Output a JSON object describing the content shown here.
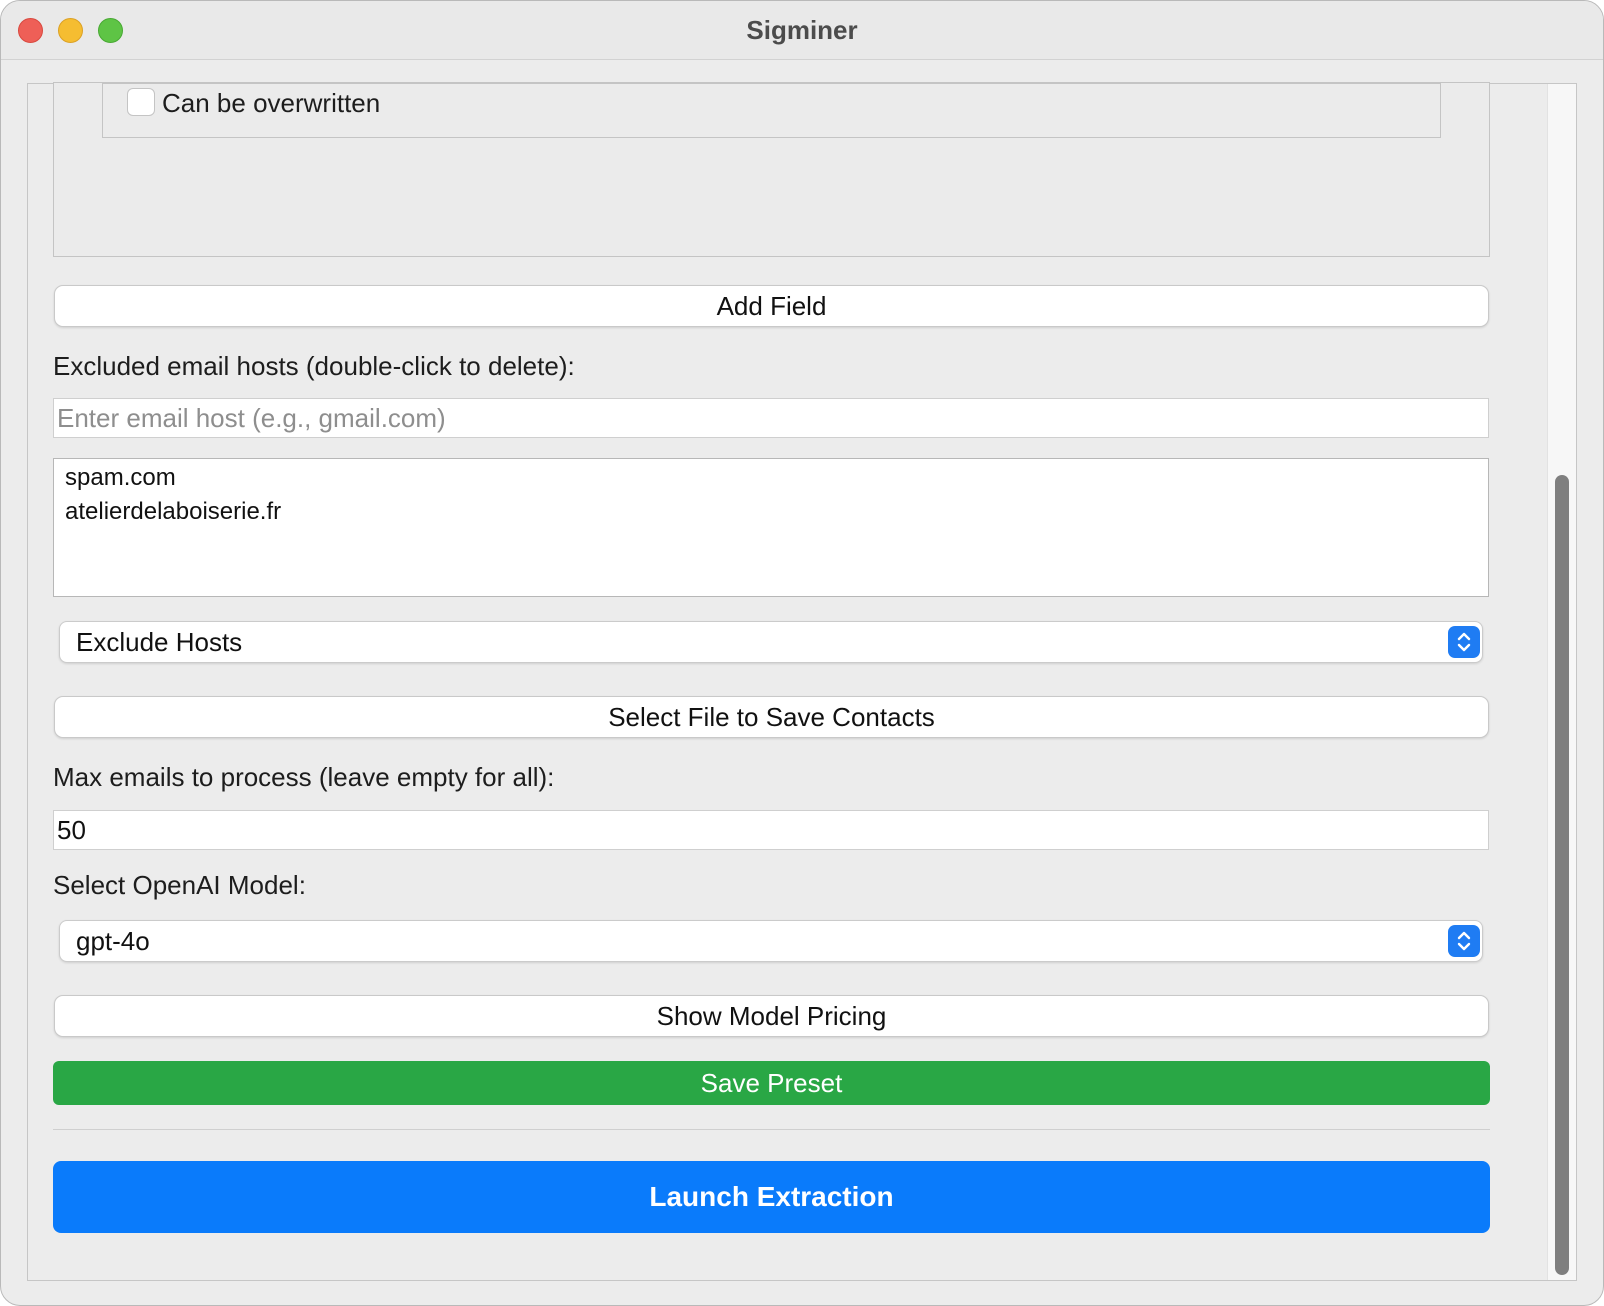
{
  "window": {
    "title": "Sigminer"
  },
  "fields": {
    "overwrite_checkbox_label": "Can be overwritten",
    "overwrite_checked": false
  },
  "add_field_button": "Add Field",
  "excluded_hosts": {
    "label": "Excluded email hosts (double-click to delete):",
    "input_placeholder": "Enter email host (e.g., gmail.com)",
    "input_value": "",
    "items": [
      "spam.com",
      "atelierdelaboiserie.fr"
    ]
  },
  "host_mode_select": {
    "selected": "Exclude Hosts"
  },
  "select_file_button": "Select File to Save Contacts",
  "max_emails": {
    "label": "Max emails to process (leave empty for all):",
    "value": "50"
  },
  "model": {
    "label": "Select OpenAI Model:",
    "selected": "gpt-4o"
  },
  "pricing_button": "Show Model Pricing",
  "save_preset_button": "Save Preset",
  "launch_button": "Launch Extraction",
  "colors": {
    "green": "#29a745",
    "blue": "#0a7bfb",
    "select_arrow": "#1f7cf3"
  }
}
